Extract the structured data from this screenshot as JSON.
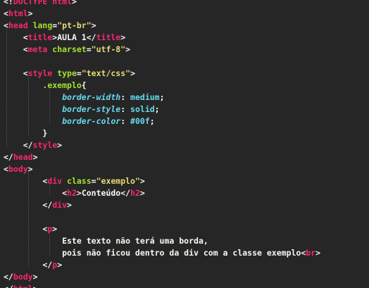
{
  "code_lines": [
    [
      {
        "t": "<!",
        "c": "punct"
      },
      {
        "t": "DOCTYPE html",
        "c": "doctype"
      },
      {
        "t": ">",
        "c": "punct"
      }
    ],
    [
      {
        "t": "<",
        "c": "punct"
      },
      {
        "t": "html",
        "c": "tag"
      },
      {
        "t": ">",
        "c": "punct"
      }
    ],
    [
      {
        "t": "<",
        "c": "punct"
      },
      {
        "t": "head",
        "c": "tag"
      },
      {
        "t": " ",
        "c": "text"
      },
      {
        "t": "lang",
        "c": "attr"
      },
      {
        "t": "=",
        "c": "punct"
      },
      {
        "t": "\"pt-br\"",
        "c": "str"
      },
      {
        "t": ">",
        "c": "punct"
      }
    ],
    [
      {
        "t": "    <",
        "c": "punct"
      },
      {
        "t": "title",
        "c": "tag"
      },
      {
        "t": ">",
        "c": "punct"
      },
      {
        "t": "AULA 1",
        "c": "text"
      },
      {
        "t": "</",
        "c": "punct"
      },
      {
        "t": "title",
        "c": "tag"
      },
      {
        "t": ">",
        "c": "punct"
      }
    ],
    [
      {
        "t": "    <",
        "c": "punct"
      },
      {
        "t": "meta",
        "c": "tag"
      },
      {
        "t": " ",
        "c": "text"
      },
      {
        "t": "charset",
        "c": "attr"
      },
      {
        "t": "=",
        "c": "punct"
      },
      {
        "t": "\"utf-8\"",
        "c": "str"
      },
      {
        "t": ">",
        "c": "punct"
      }
    ],
    [],
    [
      {
        "t": "    <",
        "c": "punct"
      },
      {
        "t": "style",
        "c": "tag"
      },
      {
        "t": " ",
        "c": "text"
      },
      {
        "t": "type",
        "c": "attr"
      },
      {
        "t": "=",
        "c": "punct"
      },
      {
        "t": "\"text/css\"",
        "c": "str"
      },
      {
        "t": ">",
        "c": "punct"
      }
    ],
    [
      {
        "t": "        ",
        "c": "text"
      },
      {
        "t": ".exemplo",
        "c": "sel"
      },
      {
        "t": "{",
        "c": "punct"
      }
    ],
    [
      {
        "t": "            ",
        "c": "text"
      },
      {
        "t": "border-width",
        "c": "prop"
      },
      {
        "t": ": ",
        "c": "punct"
      },
      {
        "t": "medium",
        "c": "val"
      },
      {
        "t": ";",
        "c": "punct"
      }
    ],
    [
      {
        "t": "            ",
        "c": "text"
      },
      {
        "t": "border-style",
        "c": "prop"
      },
      {
        "t": ": ",
        "c": "punct"
      },
      {
        "t": "solid",
        "c": "val"
      },
      {
        "t": ";",
        "c": "punct"
      }
    ],
    [
      {
        "t": "            ",
        "c": "text"
      },
      {
        "t": "border-color",
        "c": "prop"
      },
      {
        "t": ": ",
        "c": "punct"
      },
      {
        "t": "#00f",
        "c": "val"
      },
      {
        "t": ";",
        "c": "punct"
      }
    ],
    [
      {
        "t": "        }",
        "c": "punct"
      }
    ],
    [
      {
        "t": "    </",
        "c": "punct"
      },
      {
        "t": "style",
        "c": "tag"
      },
      {
        "t": ">",
        "c": "punct"
      }
    ],
    [
      {
        "t": "</",
        "c": "punct"
      },
      {
        "t": "head",
        "c": "tag"
      },
      {
        "t": ">",
        "c": "punct"
      }
    ],
    [
      {
        "t": "<",
        "c": "punct"
      },
      {
        "t": "body",
        "c": "tag"
      },
      {
        "t": ">",
        "c": "punct"
      }
    ],
    [
      {
        "t": "        <",
        "c": "punct"
      },
      {
        "t": "div",
        "c": "tag"
      },
      {
        "t": " ",
        "c": "text"
      },
      {
        "t": "class",
        "c": "attr"
      },
      {
        "t": "=",
        "c": "punct"
      },
      {
        "t": "\"exemplo\"",
        "c": "str"
      },
      {
        "t": ">",
        "c": "punct"
      }
    ],
    [
      {
        "t": "            <",
        "c": "punct"
      },
      {
        "t": "h2",
        "c": "tag"
      },
      {
        "t": ">",
        "c": "punct"
      },
      {
        "t": "Conteúdo",
        "c": "text"
      },
      {
        "t": "</",
        "c": "punct"
      },
      {
        "t": "h2",
        "c": "tag"
      },
      {
        "t": ">",
        "c": "punct"
      }
    ],
    [
      {
        "t": "        </",
        "c": "punct"
      },
      {
        "t": "div",
        "c": "tag"
      },
      {
        "t": ">",
        "c": "punct"
      }
    ],
    [],
    [
      {
        "t": "        <",
        "c": "punct"
      },
      {
        "t": "p",
        "c": "tag"
      },
      {
        "t": ">",
        "c": "punct"
      }
    ],
    [
      {
        "t": "            Este texto não terá uma borda,",
        "c": "text"
      }
    ],
    [
      {
        "t": "            pois não ficou dentro da div com a classe exemplo",
        "c": "text"
      },
      {
        "t": "<",
        "c": "punct"
      },
      {
        "t": "br",
        "c": "tag"
      },
      {
        "t": ">",
        "c": "punct"
      }
    ],
    [
      {
        "t": "        </",
        "c": "punct"
      },
      {
        "t": "p",
        "c": "tag"
      },
      {
        "t": ">",
        "c": "punct"
      }
    ],
    [
      {
        "t": "</",
        "c": "punct"
      },
      {
        "t": "body",
        "c": "tag"
      },
      {
        "t": ">",
        "c": "punct"
      }
    ],
    [
      {
        "t": "</",
        "c": "punct"
      },
      {
        "t": "html",
        "c": "tag"
      },
      {
        "t": ">",
        "c": "punct"
      }
    ]
  ],
  "colors": {
    "background": "#262626",
    "tag": "#f92672",
    "attribute": "#a6e22e",
    "string": "#e6db74",
    "selector": "#a6e22e",
    "property": "#66d9ef",
    "value": "#66d9ef",
    "text": "#f8f8f2"
  }
}
